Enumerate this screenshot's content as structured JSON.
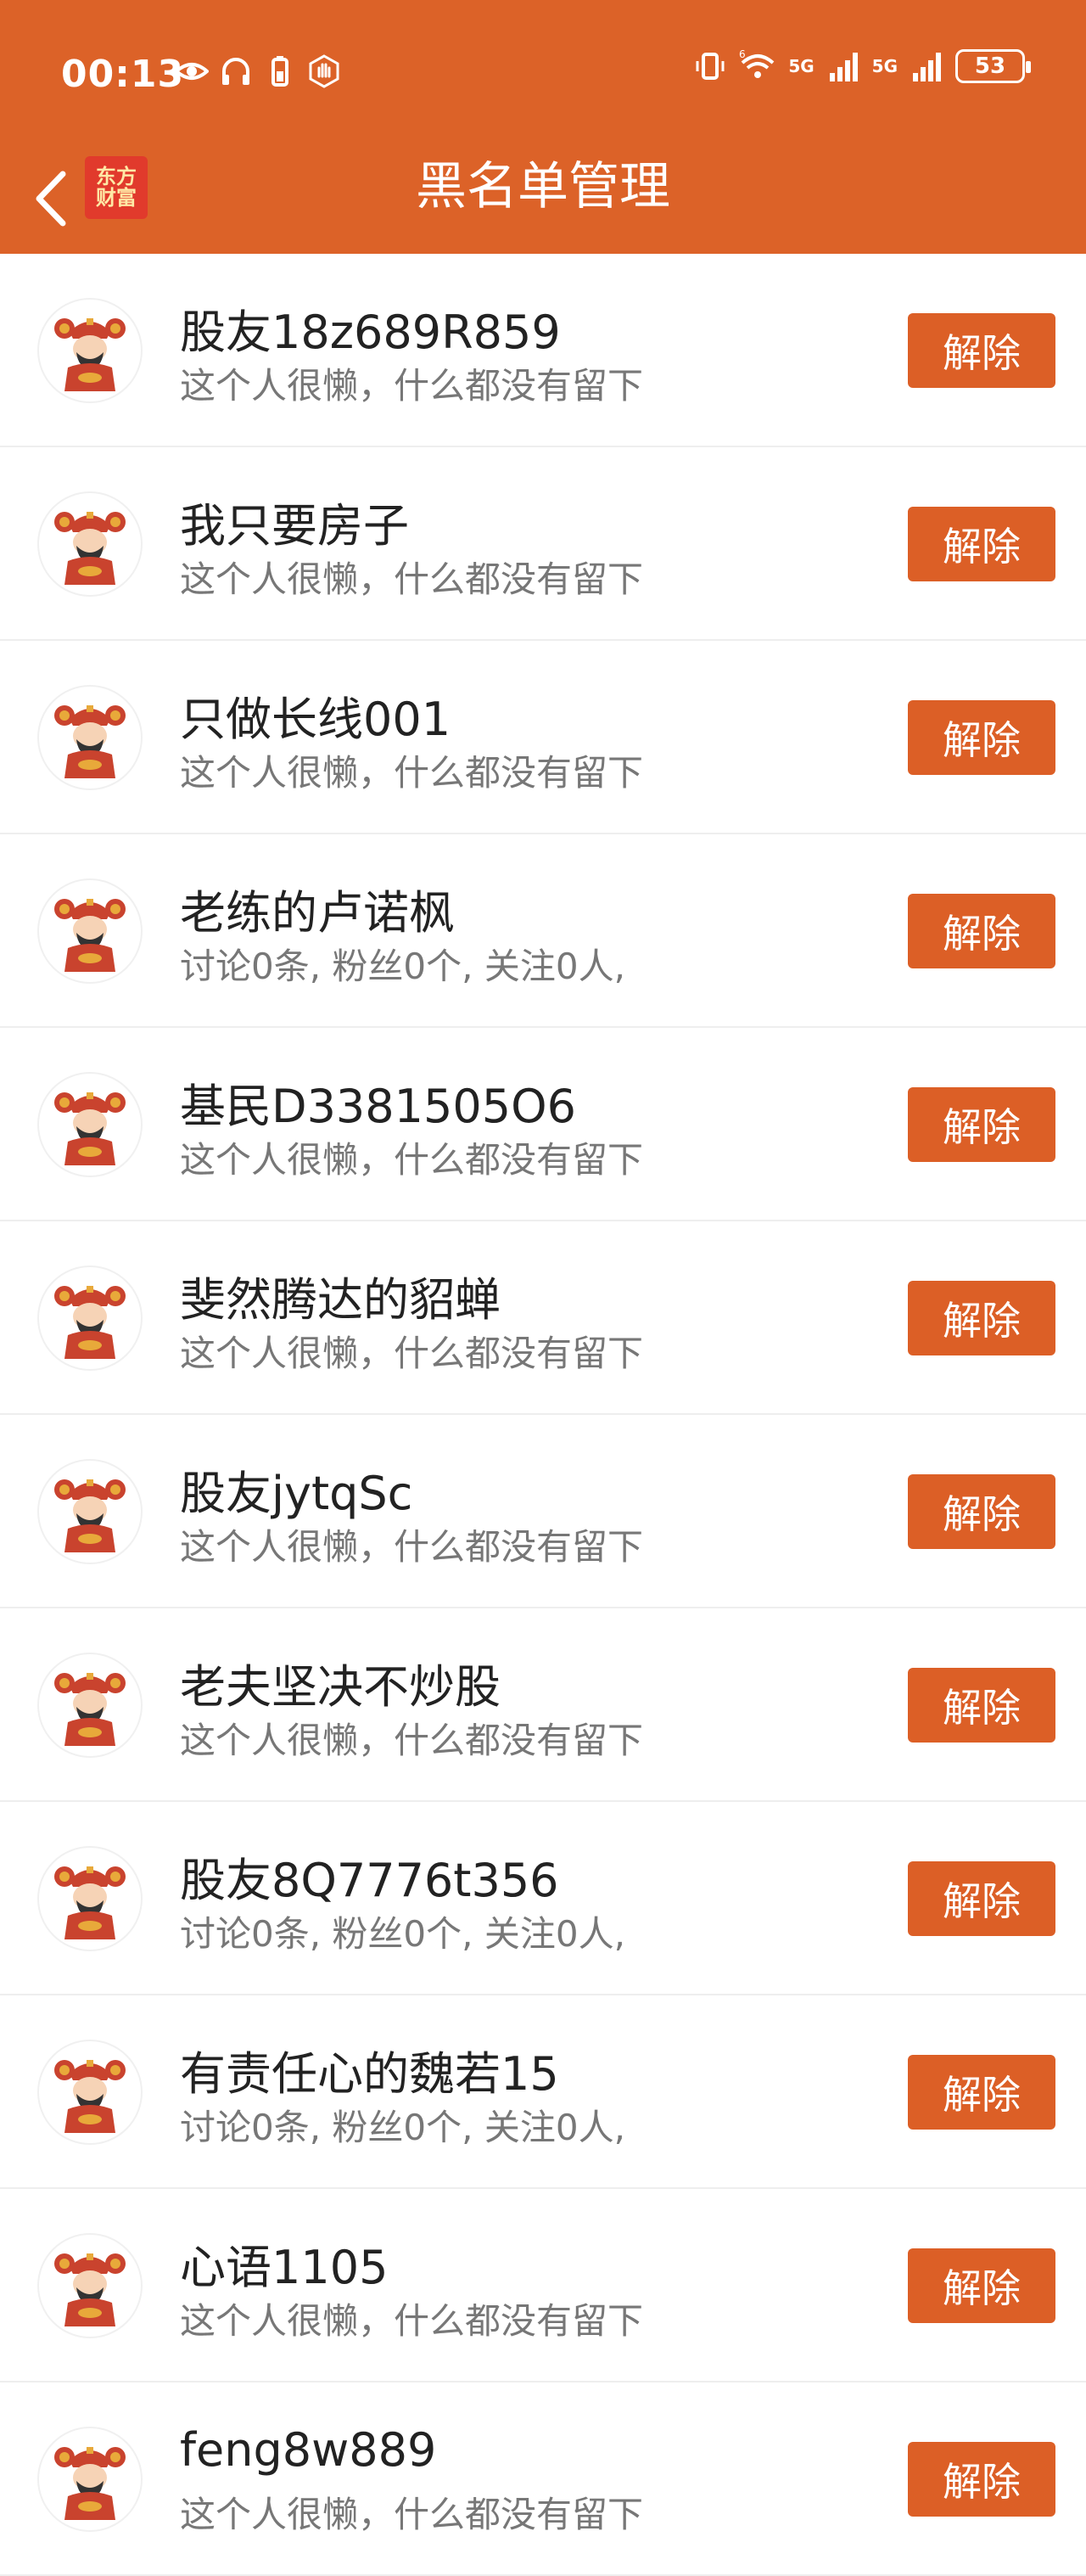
{
  "status_bar": {
    "time": "00:13",
    "icons_left": [
      "eye-icon",
      "headphones-icon",
      "battery-saver-icon",
      "hand-icon"
    ],
    "icons_right": [
      "vibrate-icon",
      "wifi-icon",
      "signal-icon",
      "signal-icon"
    ],
    "wifi_badge": "6",
    "net_label_1": "5G",
    "net_label_2": "5G",
    "battery": "53"
  },
  "header": {
    "title": "黑名单管理",
    "logo_line1": "东方",
    "logo_line2": "财富",
    "back_icon": "chevron-left-icon",
    "bg_color": "#DC6228"
  },
  "blacklist": [
    {
      "name": "股友18z689R859",
      "desc": "这个人很懒，什么都没有留下",
      "action": "解除"
    },
    {
      "name": "我只要房子",
      "desc": "这个人很懒，什么都没有留下",
      "action": "解除"
    },
    {
      "name": "只做长线001",
      "desc": "这个人很懒，什么都没有留下",
      "action": "解除"
    },
    {
      "name": "老练的卢诺枫",
      "desc": "讨论0条, 粉丝0个, 关注0人,",
      "action": "解除"
    },
    {
      "name": "基民D3381505O6",
      "desc": "这个人很懒，什么都没有留下",
      "action": "解除"
    },
    {
      "name": "斐然腾达的貂蝉",
      "desc": "这个人很懒，什么都没有留下",
      "action": "解除"
    },
    {
      "name": "股友jytqSc",
      "desc": "这个人很懒，什么都没有留下",
      "action": "解除"
    },
    {
      "name": "老夫坚决不炒股",
      "desc": "这个人很懒，什么都没有留下",
      "action": "解除"
    },
    {
      "name": "股友8Q7776t356",
      "desc": "讨论0条, 粉丝0个, 关注0人,",
      "action": "解除"
    },
    {
      "name": "有责任心的魏若15",
      "desc": "讨论0条, 粉丝0个, 关注0人,",
      "action": "解除"
    },
    {
      "name": "心语1105",
      "desc": "这个人很懒，什么都没有留下",
      "action": "解除"
    },
    {
      "name": "feng8w889",
      "desc": "这个人很懒，什么都没有留下",
      "action": "解除"
    }
  ],
  "colors": {
    "accent": "#DC5F26",
    "name_text": "#222222",
    "desc_text": "#777777"
  }
}
